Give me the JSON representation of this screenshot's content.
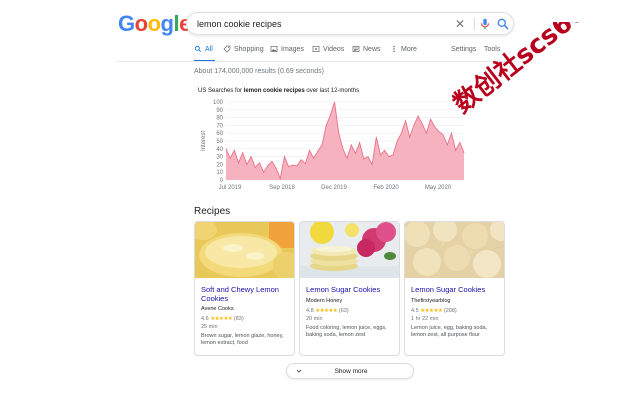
{
  "logo": {
    "letters": [
      "G",
      "o",
      "o",
      "g",
      "l",
      "e"
    ],
    "colors": [
      "#4285f4",
      "#ea4335",
      "#fbbc05",
      "#4285f4",
      "#34a853",
      "#ea4335"
    ]
  },
  "search": {
    "query": "lemon cookie recipes",
    "clear_icon": "close-icon",
    "mic_icon": "mic-icon",
    "search_icon": "magnifier-icon"
  },
  "tabs": [
    {
      "label": "All",
      "icon": "magnifier-icon",
      "active": true
    },
    {
      "label": "Shopping",
      "icon": "tag-icon",
      "active": false
    },
    {
      "label": "Images",
      "icon": "image-icon",
      "active": false
    },
    {
      "label": "Videos",
      "icon": "play-icon",
      "active": false
    },
    {
      "label": "News",
      "icon": "newspaper-icon",
      "active": false
    },
    {
      "label": "More",
      "icon": "kebab-icon",
      "active": false
    }
  ],
  "tools": {
    "settings": "Settings",
    "tools": "Tools"
  },
  "result_stats": "About 174,000,000 results (0.69 seconds)",
  "trends": {
    "title_prefix": "US Searches for ",
    "title_query": "lemon cookie recipes",
    "title_suffix": " over last 12-months"
  },
  "chart_data": {
    "type": "area",
    "title": "US Searches for lemon cookie recipes over last 12-months",
    "ylabel": "Interest",
    "xlabel": "",
    "ylim": [
      0,
      100
    ],
    "yticks": [
      0,
      10,
      20,
      30,
      40,
      50,
      60,
      70,
      80,
      90,
      100
    ],
    "xtick_labels": [
      "Jul 2019",
      "Sep 2018",
      "Dec 2019",
      "Feb 2020",
      "May 2020"
    ],
    "grid": true,
    "color": "#f4a6b4",
    "line_color": "#e8708a",
    "values": [
      40,
      28,
      38,
      22,
      35,
      20,
      30,
      16,
      22,
      10,
      18,
      24,
      15,
      2,
      30,
      17,
      19,
      18,
      26,
      21,
      38,
      28,
      37,
      45,
      70,
      83,
      100,
      60,
      40,
      28,
      45,
      34,
      48,
      27,
      30,
      20,
      55,
      32,
      38,
      30,
      32,
      50,
      60,
      76,
      55,
      70,
      82,
      72,
      60,
      78,
      68,
      62,
      58,
      45,
      60,
      38,
      48,
      35
    ]
  },
  "recipes": {
    "heading": "Recipes",
    "cards": [
      {
        "title": "Soft and Chewy Lemon Cookies",
        "source": "Averie Cooks",
        "rating": "4.6",
        "stars": "★★★★★",
        "reviews": "(83)",
        "time": "25 min",
        "ingredients": "Brown sugar, lemon glaze, honey, lemon extract, food"
      },
      {
        "title": "Lemon Sugar Cookies",
        "source": "Modern Honey",
        "rating": "4.8",
        "stars": "★★★★★",
        "reviews": "(63)",
        "time": "20 min",
        "ingredients": "Food coloring, lemon juice, eggs, baking soda, lemon zest"
      },
      {
        "title": "Lemon Sugar Cookies",
        "source": "Thefirstyearblog",
        "rating": "4.5",
        "stars": "★★★★★",
        "reviews": "(208)",
        "time": "1 hr 22 min",
        "ingredients": "Lemon juice, egg, baking soda, lemon zest, all purpose flour"
      }
    ]
  },
  "show_more": {
    "label": "Show more",
    "icon": "chevron-down-icon"
  },
  "watermark": {
    "text": "数创社scs66",
    "color": "#b8001c"
  }
}
